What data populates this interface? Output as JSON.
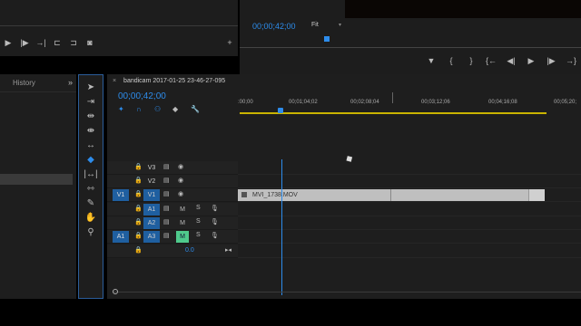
{
  "program": {
    "timecode": "00;00;42;00",
    "zoom": "Fit",
    "controls": [
      "mark-in",
      "{",
      "}",
      "go-in",
      "step-back",
      "play",
      "step-forward",
      "go-out"
    ]
  },
  "source_controls": {
    "buttons": [
      "play",
      "step-forward",
      "next",
      "insert",
      "overwrite",
      "export-frame"
    ],
    "add_label": "+"
  },
  "history": {
    "title": "History",
    "more": "»"
  },
  "tools": [
    "selection",
    "track-select",
    "ripple",
    "rolling",
    "rate-stretch",
    "razor",
    "slip",
    "pen",
    "hand",
    "zoom"
  ],
  "timeline": {
    "tab_close": "×",
    "sequence_name": "bandicam 2017-01-25 23-46-27-095",
    "timecode": "00;00;42;00",
    "ruler_labels": [
      ":00;00",
      "00;01;04;02",
      "00;02;08;04",
      "00;03;12;06",
      "00;04;16;08",
      "00;05;20;"
    ],
    "tracks": [
      {
        "name": "V3",
        "type": "video",
        "source": ""
      },
      {
        "name": "V2",
        "type": "video",
        "source": ""
      },
      {
        "name": "V1",
        "type": "video",
        "source": "V1"
      },
      {
        "name": "A1",
        "type": "audio",
        "source": ""
      },
      {
        "name": "A2",
        "type": "audio",
        "source": ""
      },
      {
        "name": "A3",
        "type": "audio",
        "source": "A1"
      }
    ],
    "mute_label": "M",
    "solo_label": "S",
    "master_volume": "0.0",
    "clip_name": "MVI_1738.MOV"
  },
  "colors": {
    "accent": "#2d8ceb",
    "work_area": "#c9b400",
    "active_mute": "#4fc98c"
  }
}
